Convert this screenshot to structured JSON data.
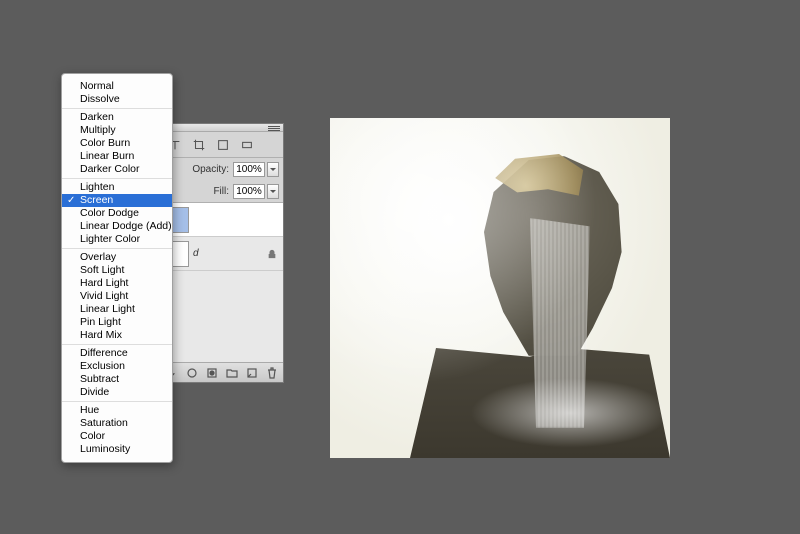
{
  "blend_menu": {
    "groups": [
      {
        "items": [
          "Normal",
          "Dissolve"
        ]
      },
      {
        "items": [
          "Darken",
          "Multiply",
          "Color Burn",
          "Linear Burn",
          "Darker Color"
        ]
      },
      {
        "items": [
          "Lighten",
          "Screen",
          "Color Dodge",
          "Linear Dodge (Add)",
          "Lighter Color"
        ]
      },
      {
        "items": [
          "Overlay",
          "Soft Light",
          "Hard Light",
          "Vivid Light",
          "Linear Light",
          "Pin Light",
          "Hard Mix"
        ]
      },
      {
        "items": [
          "Difference",
          "Exclusion",
          "Subtract",
          "Divide"
        ]
      },
      {
        "items": [
          "Hue",
          "Saturation",
          "Color",
          "Luminosity"
        ]
      }
    ],
    "selected": "Screen",
    "checkmark": "✓"
  },
  "layers_panel": {
    "opacity_label": "Opacity:",
    "opacity_value": "100%",
    "fill_label": "Fill:",
    "fill_value": "100%",
    "layers": [
      {
        "name": "",
        "locked": false,
        "selected": true,
        "thumb_color": "#a5bfe8"
      },
      {
        "name": "d",
        "locked": true,
        "selected": false,
        "thumb_color": "#e8e8e8"
      }
    ]
  },
  "icons": {
    "type": "type-icon",
    "crop": "crop-icon",
    "rect": "rect-icon",
    "more": "more-icon",
    "link": "link-icon",
    "fx": "fx-icon",
    "mask": "mask-icon",
    "folder": "folder-icon",
    "new": "new-layer-icon",
    "trash": "trash-icon",
    "lock": "lock-icon"
  }
}
